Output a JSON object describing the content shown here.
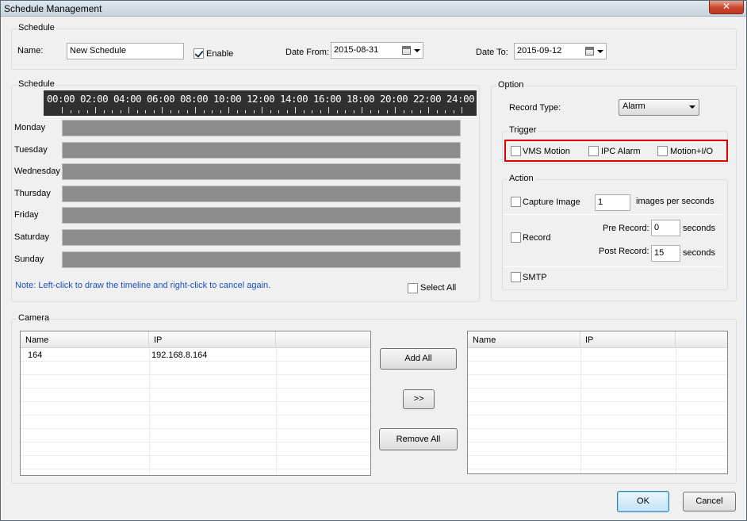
{
  "window": {
    "title": "Schedule Management",
    "close_label": "✕"
  },
  "schedule_top": {
    "legend": "Schedule",
    "name_label": "Name:",
    "name_value": "New Schedule",
    "enable_label": "Enable",
    "enable_checked": true,
    "date_from_label": "Date From:",
    "date_from_value": "2015-08-31",
    "date_to_label": "Date To:",
    "date_to_value": "2015-09-12"
  },
  "timeline": {
    "legend": "Schedule",
    "hours": [
      "00:00",
      "02:00",
      "04:00",
      "06:00",
      "08:00",
      "10:00",
      "12:00",
      "14:00",
      "16:00",
      "18:00",
      "20:00",
      "22:00",
      "24:00"
    ],
    "days": [
      "Monday",
      "Tuesday",
      "Wednesday",
      "Thursday",
      "Friday",
      "Saturday",
      "Sunday"
    ],
    "note": "Note: Left-click to draw the timeline and right-click to cancel again.",
    "select_all_label": "Select All"
  },
  "option": {
    "legend": "Option",
    "record_type_label": "Record Type:",
    "record_type_value": "Alarm",
    "trigger": {
      "legend": "Trigger",
      "vms_motion": "VMS Motion",
      "ipc_alarm": "IPC Alarm",
      "motion_io": "Motion+I/O"
    },
    "action": {
      "legend": "Action",
      "capture_image": "Capture Image",
      "capture_value": "1",
      "capture_unit": "images per seconds",
      "record": "Record",
      "pre_record_label": "Pre Record:",
      "pre_record_value": "0",
      "post_record_label": "Post Record:",
      "post_record_value": "15",
      "seconds": "seconds",
      "smtp": "SMTP"
    }
  },
  "camera": {
    "legend": "Camera",
    "left_columns": [
      "Name",
      "IP",
      ""
    ],
    "left_rows": [
      {
        "name": "164",
        "ip": "192.168.8.164"
      }
    ],
    "right_columns": [
      "Name",
      "IP",
      ""
    ],
    "add_all": "Add All",
    "move": ">>",
    "remove_all": "Remove All"
  },
  "footer": {
    "ok": "OK",
    "cancel": "Cancel"
  },
  "colors": {
    "highlight": "#e00000",
    "note_text": "#1a4fc2",
    "timeline_bg": "#303030",
    "day_bar": "#8c8c8c"
  }
}
